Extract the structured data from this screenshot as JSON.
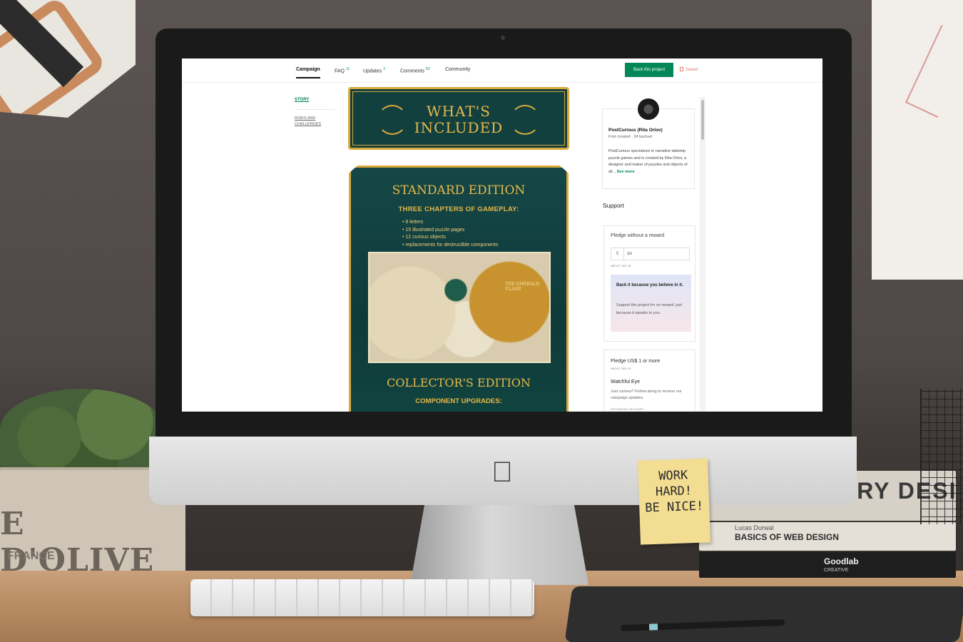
{
  "scene": {
    "sticky_note_lines": [
      "WORK",
      "HARD!",
      "BE NICE!"
    ],
    "book_titles": [
      "STORY DESIGN",
      "BASICS OF WEB DESIGN",
      "Goodlab"
    ],
    "book_author": "Lucas Durwal",
    "book_creative": "CREATIVE",
    "crate_text": "E D'OLIVE",
    "crate_sub": "FRANCE"
  },
  "nav": {
    "tabs": [
      {
        "label": "Campaign",
        "count": ""
      },
      {
        "label": "FAQ",
        "count": "11"
      },
      {
        "label": "Updates",
        "count": "3"
      },
      {
        "label": "Comments",
        "count": "63"
      },
      {
        "label": "Community",
        "count": ""
      }
    ],
    "back_label": "Back this project",
    "saved_label": "Saved"
  },
  "toc": {
    "story": "STORY",
    "risks": "RISKS AND CHALLENGES"
  },
  "content": {
    "banner_line1": "WHAT'S",
    "banner_line2": "INCLUDED",
    "standard_title": "STANDARD EDITION",
    "standard_sub": "THREE CHAPTERS OF GAMEPLAY:",
    "standard_items": [
      "8 letters",
      "15 illustrated puzzle pages",
      "12 curious objects",
      "replacements for destructible components"
    ],
    "photo_label": "THE EMERALD FLAME",
    "collector_title": "COLLECTOR'S EDITION",
    "collector_sub": "COMPONENT UPGRADES:"
  },
  "creator": {
    "name": "PostCurious (Rita Orlov)",
    "meta": "First created · 34 backed",
    "bio": "PostCurious specializes in narrative tabletop puzzle games and is created by Rita Orlov, a designer and maker of puzzles and objects of all...",
    "see_more": "See more"
  },
  "support": {
    "heading": "Support",
    "pledge_title": "Pledge without a reward",
    "currency": "$",
    "amount": "10",
    "about": "ABOUT SEK 98",
    "believe_title": "Back it because you believe in it.",
    "believe_body": "Support the project for no reward, just because it speaks to you."
  },
  "reward": {
    "title": "Pledge US$ 1 or more",
    "about": "ABOUT SEK 10",
    "name": "Watchful Eye",
    "desc": "Just curious? Follow along to receive our campaign updates.",
    "estimated": "ESTIMATED DELIVERY"
  }
}
